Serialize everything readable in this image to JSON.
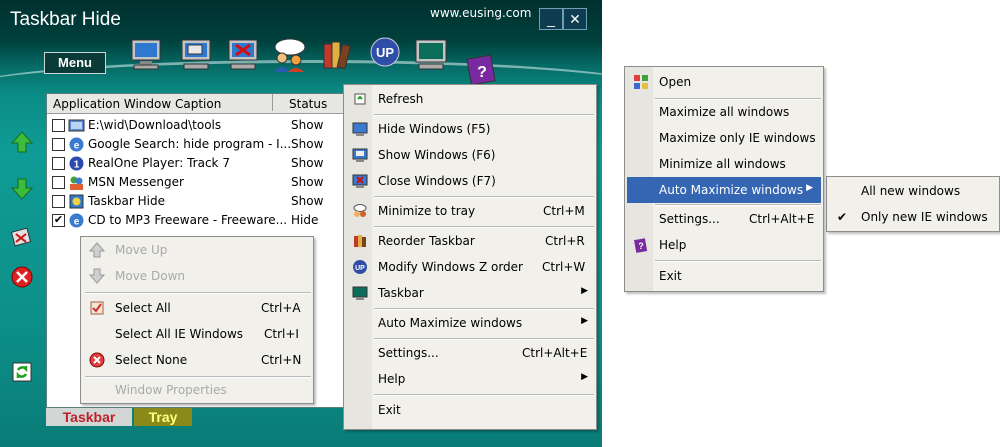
{
  "app": {
    "title": "Taskbar Hide",
    "website": "www.eusing.com",
    "minimize_glyph": "_",
    "close_glyph": "✕",
    "menu_label": "Menu",
    "toolbar_icons": [
      "monitor-icon",
      "monitor-window-icon",
      "monitor-close-icon",
      "users-icon",
      "books-icon",
      "up-icon",
      "terminal-icon",
      "help-book-icon"
    ],
    "side_icons": [
      "arrow-up-icon",
      "arrow-down-icon",
      "tray-icon",
      "close-circle-icon",
      "refresh-icon"
    ]
  },
  "list": {
    "col_caption": "Application Window Caption",
    "col_status": "Status",
    "rows": [
      {
        "checked": false,
        "caption": "E:\\wid\\Download\\tools",
        "status": "Show",
        "icon": "explorer-icon"
      },
      {
        "checked": false,
        "caption": "Google Search: hide program - I...",
        "status": "Show",
        "icon": "ie-icon"
      },
      {
        "checked": false,
        "caption": "RealOne Player: Track 7",
        "status": "Show",
        "icon": "realplayer-icon"
      },
      {
        "checked": false,
        "caption": "MSN Messenger",
        "status": "Show",
        "icon": "msn-icon"
      },
      {
        "checked": false,
        "caption": "Taskbar Hide",
        "status": "Show",
        "icon": "taskbarhide-icon"
      },
      {
        "checked": true,
        "caption": "CD to MP3 Freeware - Freeware...",
        "status": "Hide",
        "icon": "ie-icon"
      }
    ]
  },
  "ctx_list": {
    "move_up": "Move Up",
    "move_down": "Move Down",
    "select_all": "Select All",
    "select_all_sc": "Ctrl+A",
    "select_all_ie": "Select All IE Windows",
    "select_all_ie_sc": "Ctrl+I",
    "select_none": "Select None",
    "select_none_sc": "Ctrl+N",
    "window_properties": "Window Properties"
  },
  "main_menu": {
    "refresh": "Refresh",
    "hide": "Hide Windows  (F5)",
    "show": "Show Windows  (F6)",
    "close": "Close Windows  (F7)",
    "minimize_tray": "Minimize to tray",
    "minimize_tray_sc": "Ctrl+M",
    "reorder": "Reorder Taskbar",
    "reorder_sc": "Ctrl+R",
    "modify_z": "Modify Windows Z order",
    "modify_z_sc": "Ctrl+W",
    "taskbar": "Taskbar",
    "auto_max": "Auto Maximize windows",
    "settings": "Settings...",
    "settings_sc": "Ctrl+Alt+E",
    "help": "Help",
    "exit": "Exit"
  },
  "tabs": {
    "taskbar": "Taskbar",
    "tray": "Tray"
  },
  "tray_menu": {
    "open": "Open",
    "max_all": "Maximize all windows",
    "max_ie": "Maximize only IE windows",
    "min_all": "Minimize all windows",
    "auto_max": "Auto Maximize windows",
    "settings": "Settings...",
    "settings_sc": "Ctrl+Alt+E",
    "help": "Help",
    "exit": "Exit"
  },
  "sub_menu": {
    "all_new": "All new windows",
    "only_ie": "Only new IE windows",
    "check_glyph": "✔"
  },
  "colors": {
    "highlight": "#3466b3",
    "teal": "#0f9c96",
    "taskbar_tab": "#d2d7d6",
    "tray_tab": "#8a8a1a",
    "tab_text_taskbar": "#c0202a"
  }
}
